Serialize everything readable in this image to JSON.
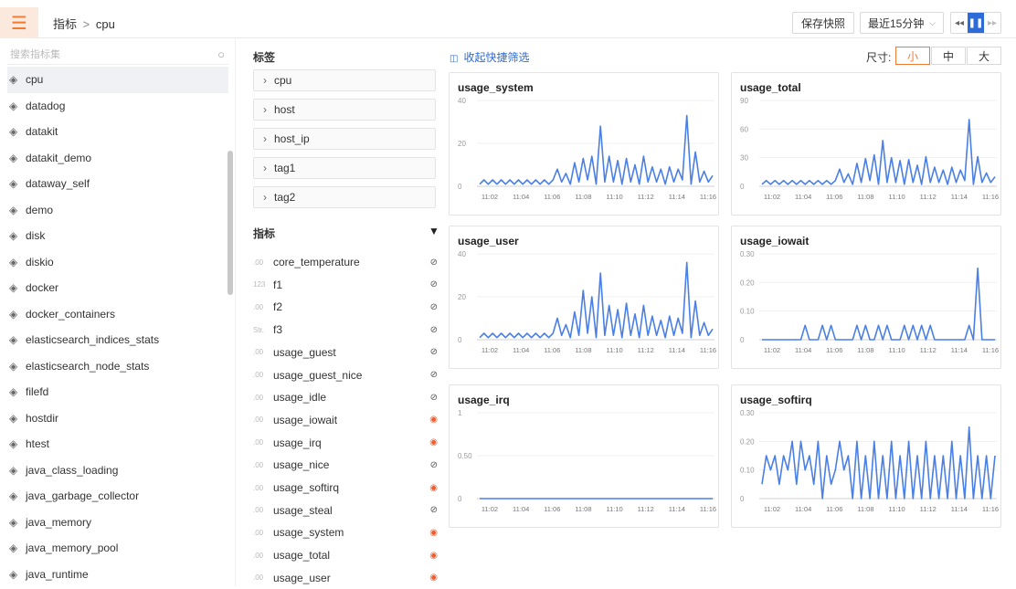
{
  "header": {
    "breadcrumb_root": "指标",
    "breadcrumb_sep": ">",
    "breadcrumb_current": "cpu",
    "save_snapshot": "保存快照",
    "time_range": "最近15分钟",
    "menu_icon": "hamburger-icon",
    "accent": "#f07a34"
  },
  "sidebar": {
    "search_placeholder": "搜索指标集",
    "items": [
      "cpu",
      "datadog",
      "datakit",
      "datakit_demo",
      "dataway_self",
      "demo",
      "disk",
      "diskio",
      "docker",
      "docker_containers",
      "elasticsearch_indices_stats",
      "elasticsearch_node_stats",
      "filefd",
      "hostdir",
      "htest",
      "java_class_loading",
      "java_garbage_collector",
      "java_memory",
      "java_memory_pool",
      "java_runtime"
    ],
    "selected": "cpu"
  },
  "tags": {
    "title": "标签",
    "items": [
      "cpu",
      "host",
      "host_ip",
      "tag1",
      "tag2"
    ]
  },
  "metrics": {
    "title": "指标",
    "fields": [
      {
        "type": ".00",
        "name": "core_temperature",
        "visible": false
      },
      {
        "type": "123",
        "name": "f1",
        "visible": false
      },
      {
        "type": ".00",
        "name": "f2",
        "visible": false
      },
      {
        "type": "Str.",
        "name": "f3",
        "visible": false
      },
      {
        "type": ".00",
        "name": "usage_guest",
        "visible": false
      },
      {
        "type": ".00",
        "name": "usage_guest_nice",
        "visible": false
      },
      {
        "type": ".00",
        "name": "usage_idle",
        "visible": false
      },
      {
        "type": ".00",
        "name": "usage_iowait",
        "visible": true
      },
      {
        "type": ".00",
        "name": "usage_irq",
        "visible": true
      },
      {
        "type": ".00",
        "name": "usage_nice",
        "visible": false
      },
      {
        "type": ".00",
        "name": "usage_softirq",
        "visible": true
      },
      {
        "type": ".00",
        "name": "usage_steal",
        "visible": false
      },
      {
        "type": ".00",
        "name": "usage_system",
        "visible": true
      },
      {
        "type": ".00",
        "name": "usage_total",
        "visible": true
      },
      {
        "type": ".00",
        "name": "usage_user",
        "visible": true
      }
    ]
  },
  "toolbar": {
    "collapse_filter": "收起快捷筛选",
    "size_label": "尺寸:",
    "sizes": [
      "小",
      "中",
      "大"
    ],
    "size_selected": "小"
  },
  "chart_data": [
    {
      "type": "line",
      "title": "usage_system",
      "ylim": [
        0,
        40
      ],
      "yticks": [
        "0",
        "20",
        "40"
      ],
      "x_ticks": [
        "11:02",
        "11:04",
        "11:06",
        "11:08",
        "11:10",
        "11:12",
        "11:14",
        "11:16"
      ],
      "values": [
        1,
        3,
        1,
        3,
        1,
        3,
        1,
        3,
        1,
        3,
        1,
        3,
        1,
        3,
        1,
        3,
        1,
        3,
        8,
        2,
        6,
        1,
        11,
        2,
        13,
        3,
        14,
        1,
        28,
        2,
        14,
        2,
        12,
        1,
        13,
        2,
        10,
        1,
        14,
        2,
        9,
        2,
        8,
        1,
        9,
        2,
        8,
        3,
        33,
        1,
        16,
        2,
        7,
        2,
        5
      ]
    },
    {
      "type": "line",
      "title": "usage_total",
      "ylim": [
        0,
        90
      ],
      "yticks": [
        "0",
        "30",
        "60",
        "90"
      ],
      "x_ticks": [
        "11:02",
        "11:04",
        "11:06",
        "11:08",
        "11:10",
        "11:12",
        "11:14",
        "11:16"
      ],
      "values": [
        2,
        6,
        2,
        6,
        2,
        6,
        2,
        6,
        2,
        6,
        2,
        6,
        2,
        6,
        2,
        6,
        2,
        6,
        18,
        4,
        13,
        2,
        24,
        4,
        29,
        6,
        33,
        2,
        48,
        4,
        30,
        4,
        27,
        2,
        28,
        4,
        22,
        2,
        31,
        4,
        20,
        4,
        17,
        2,
        20,
        4,
        17,
        6,
        70,
        2,
        31,
        4,
        14,
        4,
        10
      ]
    },
    {
      "type": "line",
      "title": "usage_user",
      "ylim": [
        0,
        40
      ],
      "yticks": [
        "0",
        "20",
        "40"
      ],
      "x_ticks": [
        "11:02",
        "11:04",
        "11:06",
        "11:08",
        "11:10",
        "11:12",
        "11:14",
        "11:16"
      ],
      "values": [
        1,
        3,
        1,
        3,
        1,
        3,
        1,
        3,
        1,
        3,
        1,
        3,
        1,
        3,
        1,
        3,
        1,
        3,
        10,
        2,
        7,
        1,
        13,
        2,
        23,
        3,
        20,
        1,
        31,
        2,
        16,
        2,
        14,
        1,
        17,
        2,
        12,
        1,
        16,
        2,
        11,
        2,
        9,
        1,
        11,
        2,
        10,
        3,
        36,
        1,
        18,
        2,
        8,
        2,
        5
      ]
    },
    {
      "type": "line",
      "title": "usage_iowait",
      "ylim": [
        0,
        0.3
      ],
      "yticks": [
        "0",
        "0.10",
        "0.20",
        "0.30"
      ],
      "x_ticks": [
        "11:02",
        "11:04",
        "11:06",
        "11:08",
        "11:10",
        "11:12",
        "11:14",
        "11:16"
      ],
      "values": [
        0,
        0,
        0,
        0,
        0,
        0,
        0,
        0,
        0,
        0,
        0.05,
        0,
        0,
        0,
        0.05,
        0,
        0.05,
        0,
        0,
        0,
        0,
        0,
        0.05,
        0,
        0.05,
        0,
        0,
        0.05,
        0,
        0.05,
        0,
        0,
        0,
        0.05,
        0,
        0.05,
        0,
        0.05,
        0,
        0.05,
        0,
        0,
        0,
        0,
        0,
        0,
        0,
        0,
        0.05,
        0,
        0.25,
        0,
        0,
        0,
        0
      ]
    },
    {
      "type": "line",
      "title": "usage_irq",
      "ylim": [
        0,
        1
      ],
      "yticks": [
        "0",
        "0.50",
        "1"
      ],
      "x_ticks": [
        "11:02",
        "11:04",
        "11:06",
        "11:08",
        "11:10",
        "11:12",
        "11:14",
        "11:16"
      ],
      "values": [
        0,
        0,
        0,
        0,
        0,
        0,
        0,
        0,
        0,
        0,
        0,
        0,
        0,
        0,
        0,
        0,
        0,
        0,
        0,
        0,
        0,
        0,
        0,
        0,
        0,
        0,
        0,
        0,
        0,
        0,
        0,
        0,
        0,
        0,
        0,
        0,
        0,
        0,
        0,
        0,
        0,
        0,
        0,
        0,
        0,
        0,
        0,
        0,
        0,
        0,
        0,
        0,
        0,
        0,
        0
      ]
    },
    {
      "type": "line",
      "title": "usage_softirq",
      "ylim": [
        0,
        0.3
      ],
      "yticks": [
        "0",
        "0.10",
        "0.20",
        "0.30"
      ],
      "x_ticks": [
        "11:02",
        "11:04",
        "11:06",
        "11:08",
        "11:10",
        "11:12",
        "11:14",
        "11:16"
      ],
      "values": [
        0.05,
        0.15,
        0.1,
        0.15,
        0.05,
        0.15,
        0.1,
        0.2,
        0.05,
        0.2,
        0.1,
        0.15,
        0.05,
        0.2,
        0,
        0.15,
        0.05,
        0.1,
        0.2,
        0.1,
        0.15,
        0,
        0.2,
        0,
        0.15,
        0,
        0.2,
        0,
        0.15,
        0,
        0.2,
        0,
        0.15,
        0,
        0.2,
        0,
        0.15,
        0,
        0.2,
        0,
        0.15,
        0,
        0.15,
        0,
        0.2,
        0,
        0.15,
        0,
        0.25,
        0,
        0.15,
        0,
        0.15,
        0,
        0.15
      ]
    }
  ]
}
